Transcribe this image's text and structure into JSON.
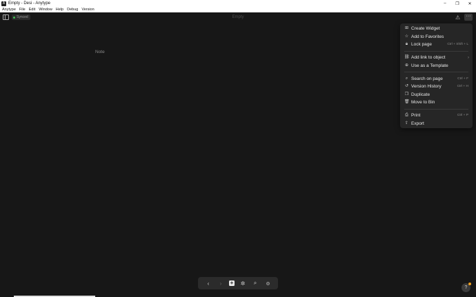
{
  "window": {
    "title": "Empty - Desi - Anytype",
    "app_icon": "A",
    "controls": {
      "minimize": "–",
      "maximize": "❐",
      "close": "✕"
    }
  },
  "menubar": [
    "Anytype",
    "File",
    "Edit",
    "Window",
    "Help",
    "Debug",
    "Version"
  ],
  "header": {
    "sync_status": "Synced",
    "page_title": "Empty",
    "more_glyph": "···"
  },
  "body": {
    "object_type": "Note"
  },
  "menu": {
    "create_widget": "Create Widget",
    "add_to_favorites": "Add to Favorites",
    "lock_page": "Lock page",
    "lock_page_shortcut": "Ctrl + Shift + L",
    "add_link": "Add link to object",
    "use_as_template": "Use as a Template",
    "search_on_page": "Search on page",
    "search_shortcut": "Ctrl + F",
    "version_history": "Version History",
    "version_shortcut": "Ctrl + H",
    "duplicate": "Duplicate",
    "move_to_bin": "Move to Bin",
    "print": "Print",
    "print_shortcut": "Ctrl + P",
    "export": "Export"
  },
  "help": {
    "label": "?"
  },
  "colors": {
    "background": "#171717",
    "menu_bg": "#262626",
    "sync_dot": "#3fb950",
    "notification": "#f0a020"
  }
}
